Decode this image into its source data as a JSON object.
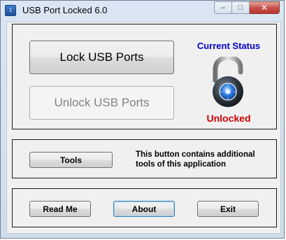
{
  "window": {
    "title": "USB Port Locked 6.0",
    "icon": "usb-app-icon",
    "controls": {
      "minimize": "–",
      "maximize": "□",
      "close": "✕"
    }
  },
  "lock_panel": {
    "lock_button": "Lock USB Ports",
    "unlock_button": "Unlock USB Ports",
    "unlock_enabled": false,
    "status_heading": "Current Status",
    "status_value": "Unlocked",
    "status_icon": "open-padlock-icon",
    "colors": {
      "heading": "#0000cc",
      "status": "#cc0000"
    }
  },
  "tools_panel": {
    "tools_button": "Tools",
    "description_line1": "This button contains additional",
    "description_line2": "tools of this application"
  },
  "footer": {
    "read_me_button": "Read Me",
    "about_button": "About",
    "exit_button": "Exit"
  }
}
